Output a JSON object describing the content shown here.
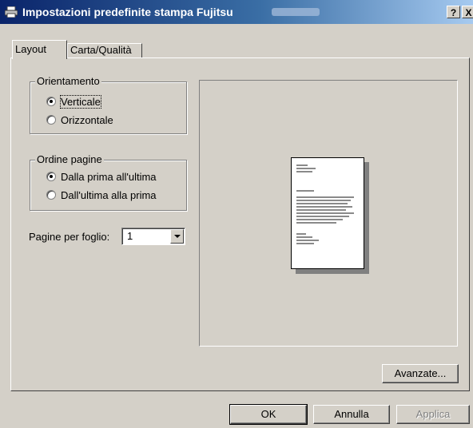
{
  "window": {
    "title": "Impostazioni predefinite stampa Fujitsu",
    "help_label": "?",
    "close_label": "X"
  },
  "tabs": [
    {
      "label": "Layout",
      "active": true
    },
    {
      "label": "Carta/Qualità",
      "active": false
    }
  ],
  "orientation": {
    "legend": "Orientamento",
    "options": [
      {
        "label": "Verticale",
        "selected": true
      },
      {
        "label": "Orizzontale",
        "selected": false
      }
    ]
  },
  "page_order": {
    "legend": "Ordine pagine",
    "options": [
      {
        "label": "Dalla prima all'ultima",
        "selected": true
      },
      {
        "label": "Dall'ultima alla prima",
        "selected": false
      }
    ]
  },
  "pages_per_sheet": {
    "label": "Pagine per foglio:",
    "value": "1"
  },
  "buttons": {
    "advanced": "Avanzate...",
    "ok": "OK",
    "cancel": "Annulla",
    "apply": "Applica"
  },
  "colors": {
    "title_gradient_start": "#0a246a",
    "title_gradient_end": "#a6caf0",
    "face": "#d4d0c8"
  }
}
